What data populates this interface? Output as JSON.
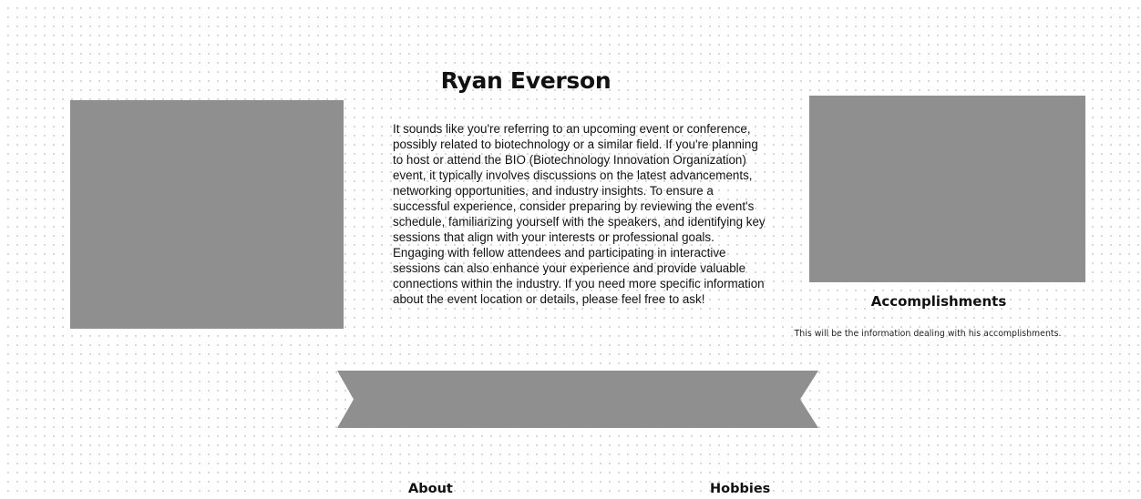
{
  "profile": {
    "name": "Ryan Everson",
    "bio": "It sounds like you're referring to an upcoming event or conference, possibly related to biotechnology or a similar field. If you're planning to host or attend the BIO (Biotechnology Innovation Organization) event, it typically involves discussions on the latest advancements, networking opportunities, and industry insights. To ensure a successful experience, consider preparing by reviewing the event's schedule, familiarizing yourself with the speakers, and identifying key sessions that align with your interests or professional goals. Engaging with fellow attendees and participating in interactive sessions can also enhance your experience and provide valuable connections within the industry. If you need more specific information about the event location or details, please feel free to ask!"
  },
  "accomplishments": {
    "heading": "Accomplishments",
    "text": "This will be the information dealing with his accomplishments."
  },
  "sections": {
    "about_heading": "About",
    "hobbies_heading": "Hobbies"
  },
  "colors": {
    "placeholder": "#8f8f8f",
    "background": "#ffffff",
    "dot_grid": "#d4d4d4",
    "text": "#111111"
  }
}
